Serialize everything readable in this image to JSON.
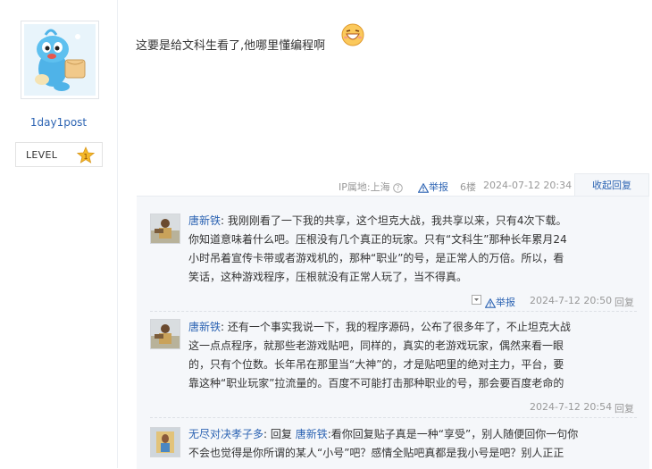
{
  "user": {
    "name": "1day1post",
    "level_label": "LEVEL",
    "level_number": "1"
  },
  "post": {
    "text": "这要是给文科生看了,他哪里懂编程啊",
    "ip_location": "IP属地:上海",
    "report_label": "举报",
    "floor": "6楼",
    "time": "2024-07-12 20:34",
    "collapse_label": "收起回复"
  },
  "replies": [
    {
      "author": "唐新铁",
      "sep": ":",
      "lines": [
        "我刚刚看了一下我的共享，这个坦克大战，我共享以来，只有4次下载。",
        "你知道意味着什么吧。压根没有几个真正的玩家。只有“文科生”那种长年累月24",
        "小时吊着宣传卡带或者游戏机的，那种“职业”的号，是正常人的万倍。所以，看",
        "笑话，这种游戏程序，压根就没有正常人玩了，当不得真。"
      ],
      "report_label": "举报",
      "time": "2024-7-12 20:50",
      "reply_label": "回复"
    },
    {
      "author": "唐新铁",
      "sep": ":",
      "lines": [
        "还有一个事实我说一下，我的程序源码，公布了很多年了，不止坦克大战",
        "这一点点程序，就那些老游戏贴吧，同样的，真实的老游戏玩家，偶然来看一眼",
        "的，只有个位数。长年吊在那里当“大神”的，才是贴吧里的绝对主力，平台，要",
        "靠这种“职业玩家”拉流量的。百度不可能打击那种职业的号，那会要百度老命的"
      ],
      "time": "2024-7-12 20:54",
      "reply_label": "回复"
    },
    {
      "author": "无尽对决孝子多",
      "sep": ":",
      "reply_word": "回复",
      "target": "唐新铁",
      "lines": [
        ":看你回复贴子真是一种“享受”，别人随便回你一句你",
        "不会也觉得是你所谓的某人“小号”吧？感情全贴吧真都是我小号是吧？别人正正"
      ]
    }
  ]
}
